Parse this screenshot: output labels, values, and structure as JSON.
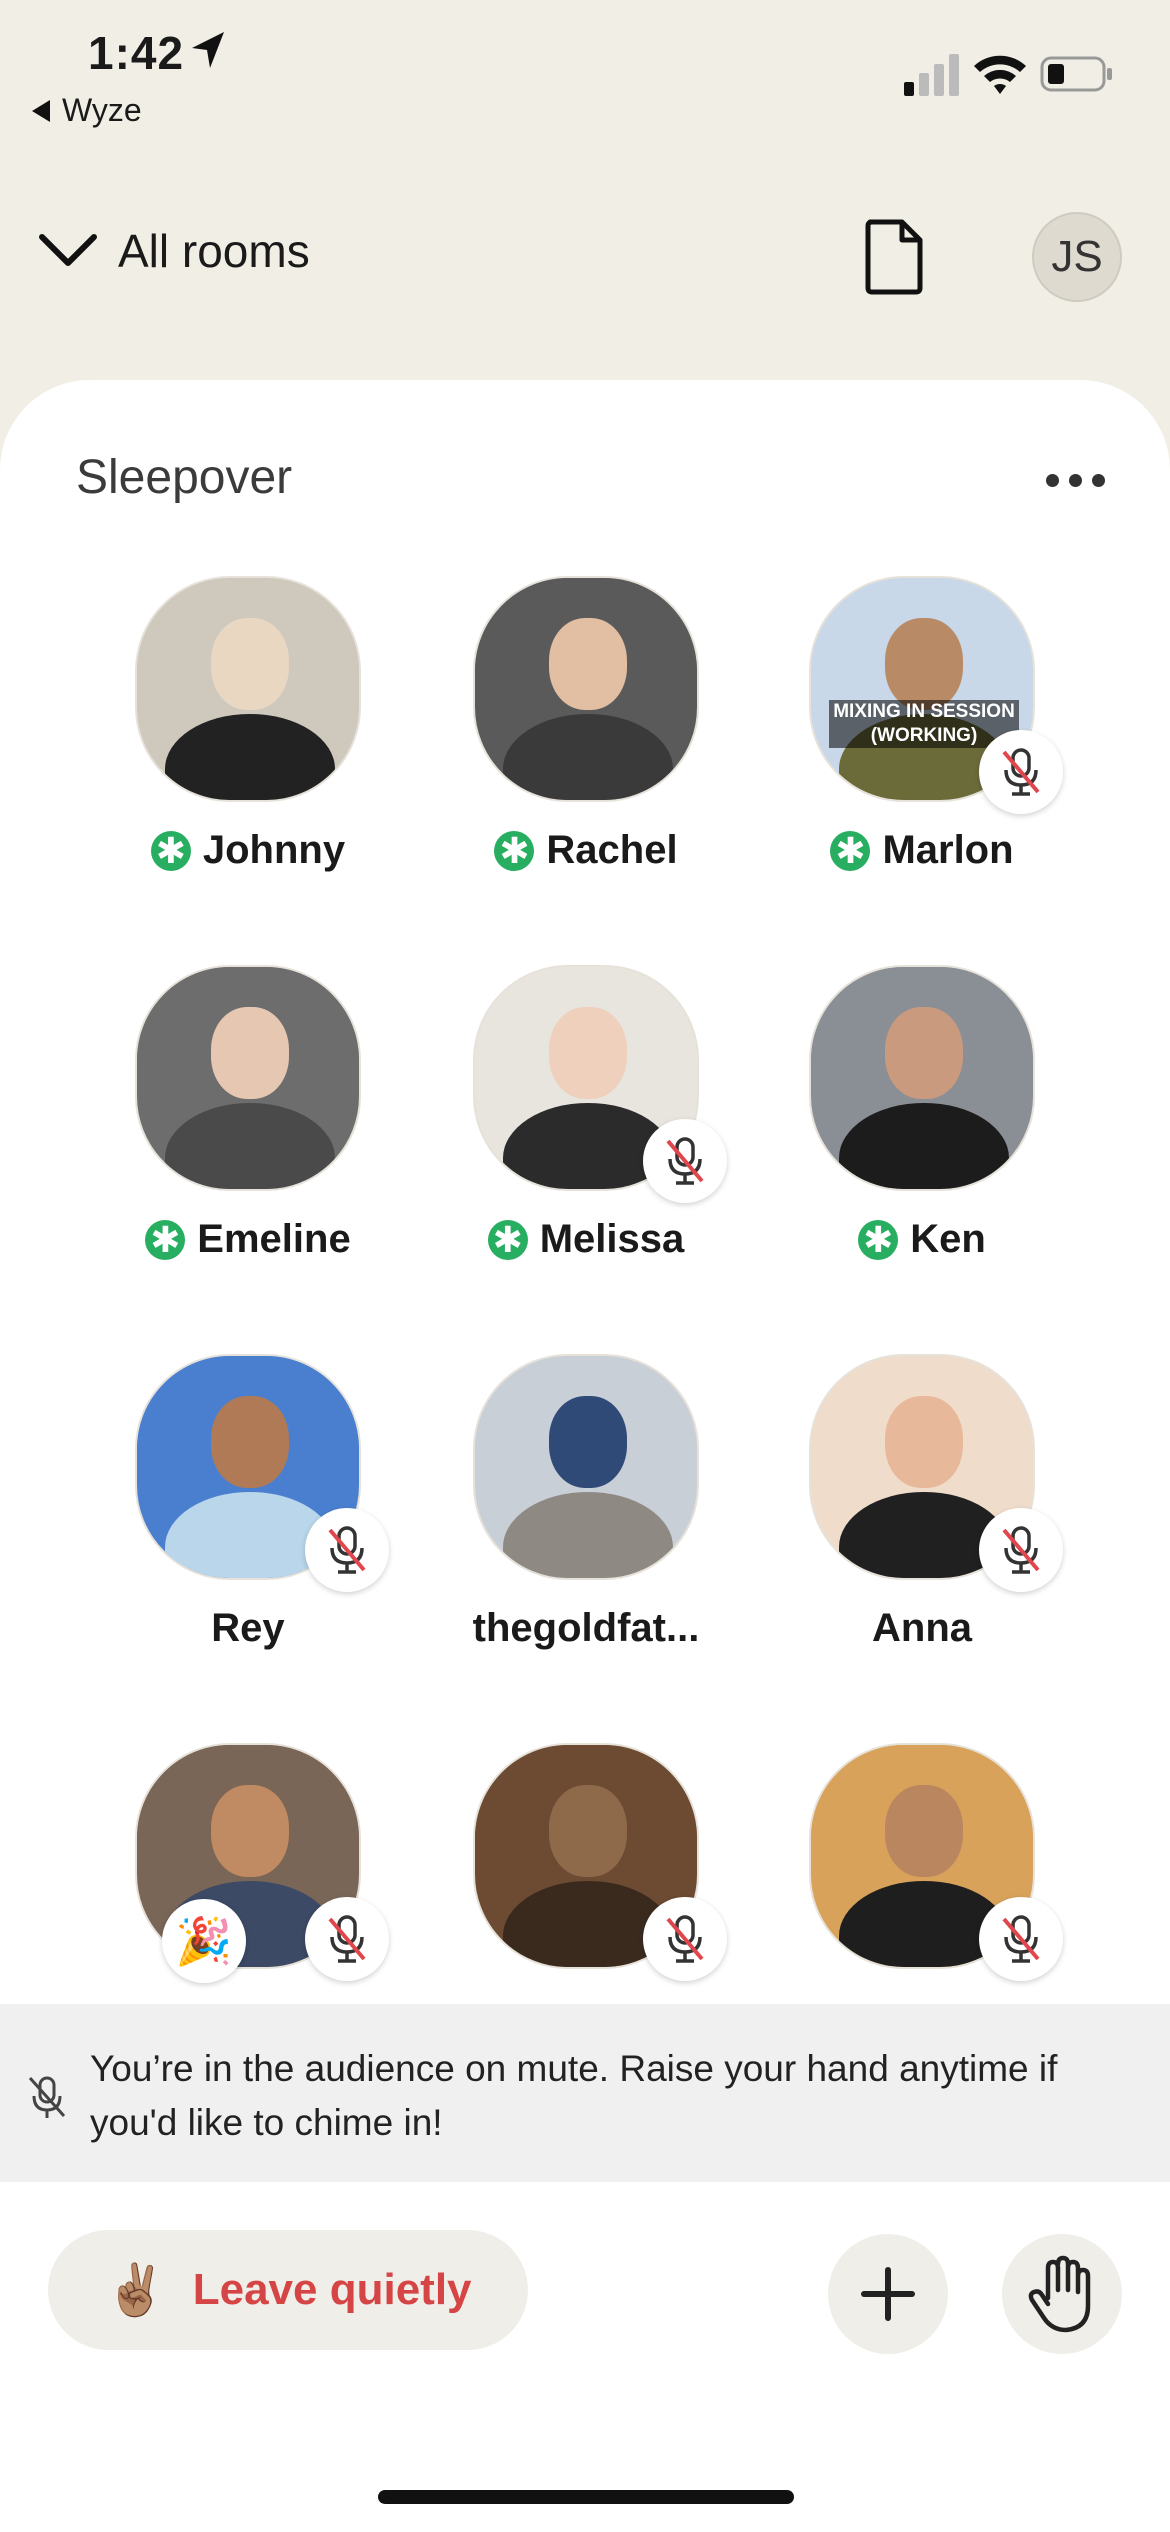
{
  "status_bar": {
    "time": "1:42",
    "back_app": "Wyze"
  },
  "header": {
    "all_rooms_label": "All rooms",
    "avatar_initials": "JS"
  },
  "room": {
    "title": "Sleepover"
  },
  "speakers": [
    {
      "name": "Johnny",
      "moderator": true,
      "muted": false,
      "party": false
    },
    {
      "name": "Rachel",
      "moderator": true,
      "muted": false,
      "party": false
    },
    {
      "name": "Marlon",
      "moderator": true,
      "muted": true,
      "party": false,
      "overlay": "MIXING IN SESSION (WORKING)"
    },
    {
      "name": "Emeline",
      "moderator": true,
      "muted": false,
      "party": false
    },
    {
      "name": "Melissa",
      "moderator": true,
      "muted": true,
      "party": false
    },
    {
      "name": "Ken",
      "moderator": true,
      "muted": false,
      "party": false
    },
    {
      "name": "Rey",
      "moderator": false,
      "muted": true,
      "party": false
    },
    {
      "name": "thegoldfat...",
      "moderator": false,
      "muted": false,
      "party": false
    },
    {
      "name": "Anna",
      "moderator": false,
      "muted": true,
      "party": false
    },
    {
      "name": "",
      "moderator": false,
      "muted": true,
      "party": true
    },
    {
      "name": "",
      "moderator": false,
      "muted": true,
      "party": false
    },
    {
      "name": "",
      "moderator": false,
      "muted": true,
      "party": false
    }
  ],
  "banner": {
    "text": "You’re in the audience on mute. Raise your hand anytime if you'd like to chime in!"
  },
  "bottom_bar": {
    "leave_label": "Leave quietly",
    "leave_emoji": "✌🏽"
  },
  "icons": {
    "moderator": "asterisk-icon",
    "mute": "muted-mic-icon",
    "raise_hand": "hand-icon",
    "add": "plus-icon"
  },
  "colors": {
    "background": "#f1efe5",
    "moderator_green": "#27ae60",
    "leave_red": "#d64545"
  }
}
